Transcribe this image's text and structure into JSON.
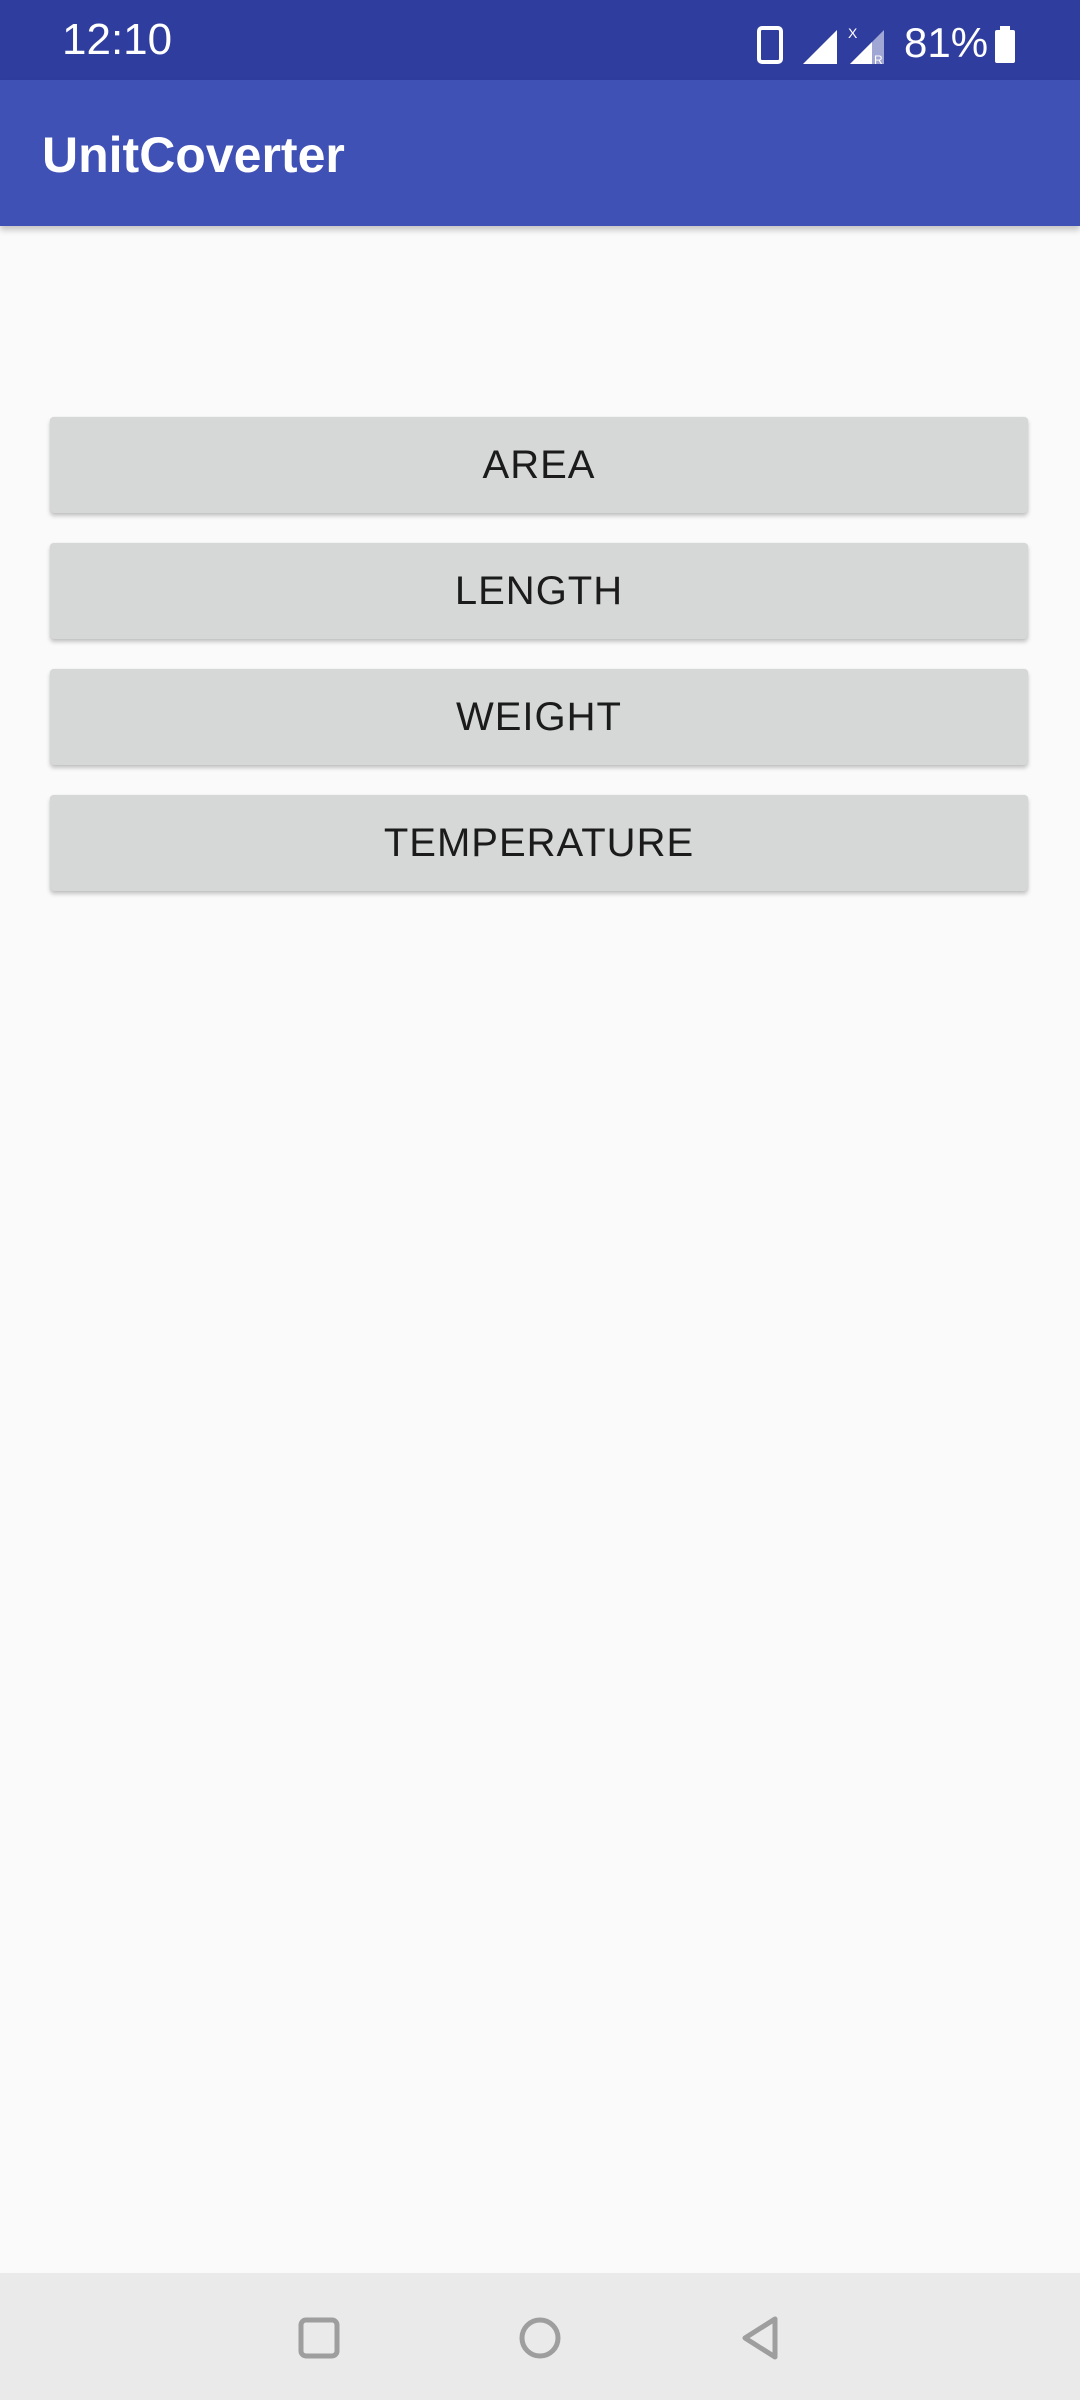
{
  "status_bar": {
    "time": "12:10",
    "battery_percent": "81%",
    "icons": [
      "phone-icon",
      "signal-icon",
      "signal-roaming-icon",
      "battery-icon"
    ],
    "background": "#2f3d9f"
  },
  "app_bar": {
    "title": "UnitCoverter",
    "background": "#3f51b5"
  },
  "buttons": [
    {
      "label": "AREA"
    },
    {
      "label": "LENGTH"
    },
    {
      "label": "WEIGHT"
    },
    {
      "label": "TEMPERATURE"
    }
  ],
  "nav_bar": {
    "items": [
      "recents-icon",
      "home-icon",
      "back-icon"
    ]
  },
  "colors": {
    "button_bg": "#d6d7d7",
    "page_bg": "#fafafa"
  }
}
